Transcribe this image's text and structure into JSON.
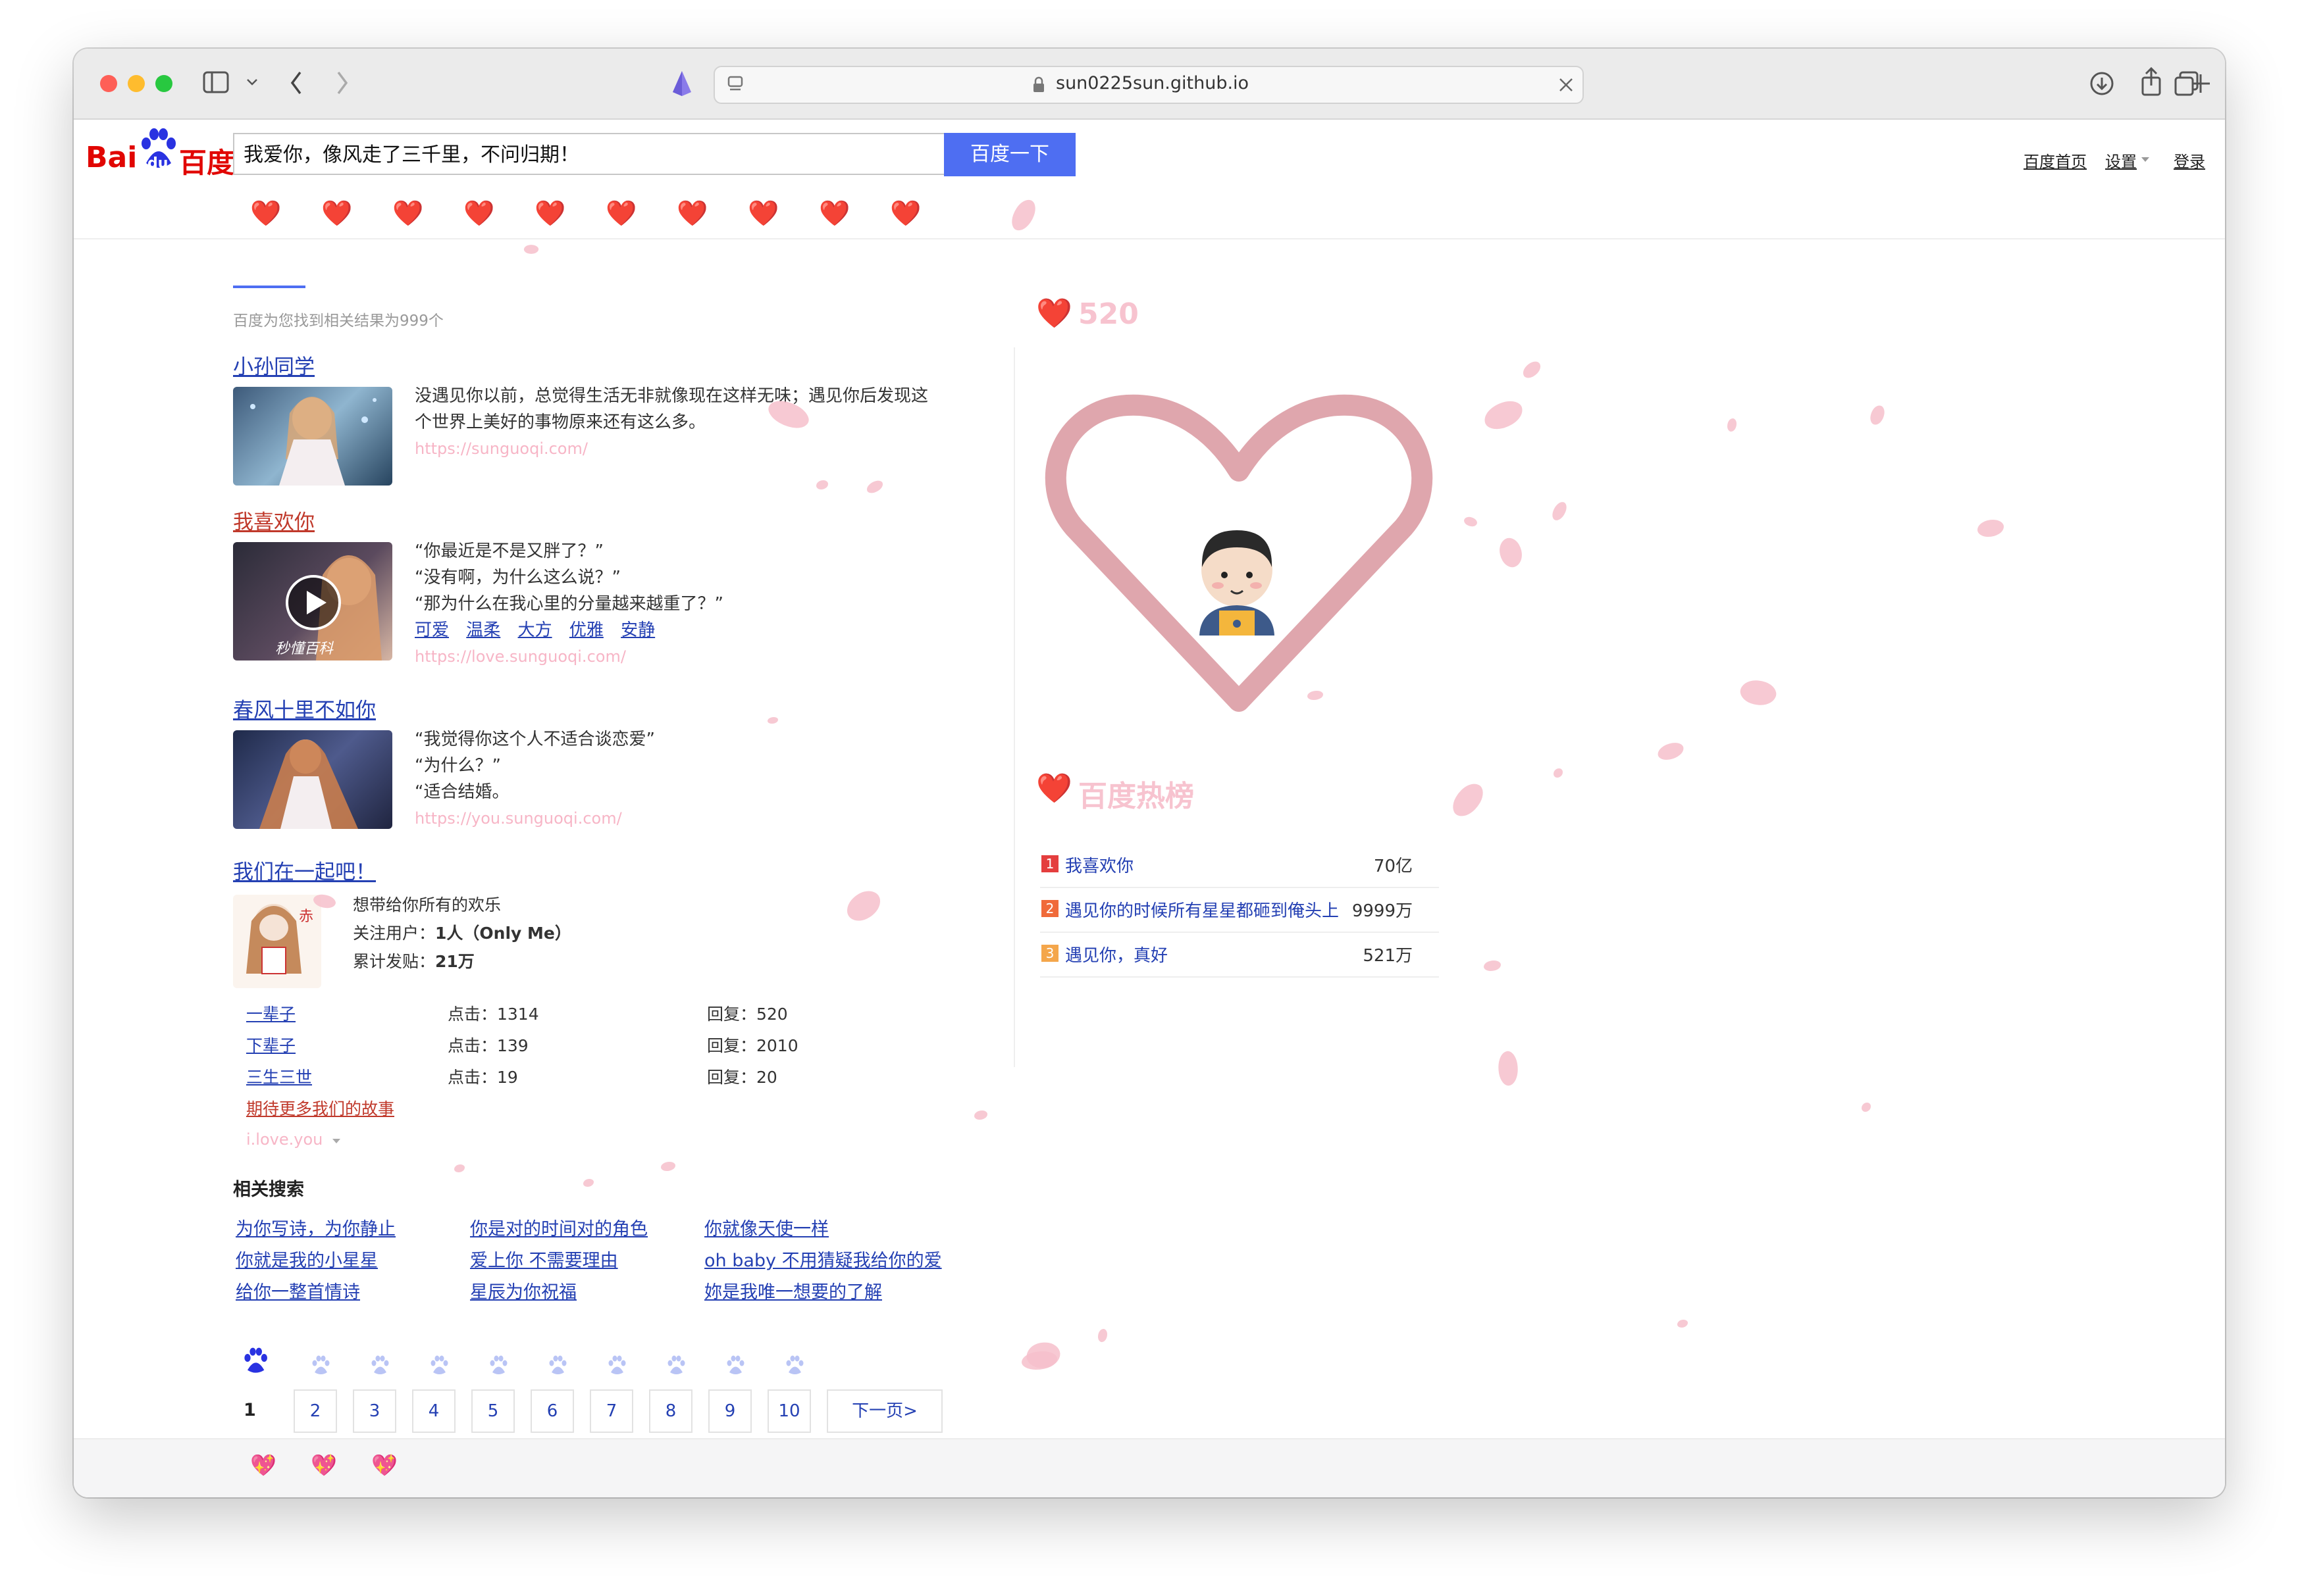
{
  "browser": {
    "url": "sun0225sun.github.io",
    "icons": {
      "sidebar": "sidebar-icon",
      "back": "chevron-left-icon",
      "forward": "chevron-right-icon",
      "download": "download-icon",
      "share": "share-icon",
      "new_tab": "plus-icon",
      "tabs": "tabs-icon",
      "lock": "lock-icon",
      "close": "close-icon",
      "extension": "extension-icon"
    }
  },
  "header": {
    "logo_bai": "Bai",
    "logo_du": "du",
    "logo_cn": "百度",
    "search_value": "我爱你，像风走了三千里，不问归期！",
    "search_button": "百度一下",
    "links": {
      "home": "百度首页",
      "settings": "设置",
      "login": "登录"
    }
  },
  "tabs": {
    "heart": "❤️",
    "count": 10
  },
  "result_count": "百度为您找到相关结果为999个",
  "results": [
    {
      "title": "小孙同学",
      "lines": [
        "没遇见你以前，总觉得生活无非就像现在这样无味；遇见你后发现这",
        "个世界上美好的事物原来还有这么多。"
      ],
      "url": "https://sunguoqi.com/"
    },
    {
      "title": "我喜欢你",
      "lines": [
        "“你最近是不是又胖了？”",
        "“没有啊，为什么这么说？”",
        "“那为什么在我心里的分量越来越重了？”"
      ],
      "tags": [
        "可爱",
        "温柔",
        "大方",
        "优雅",
        "安静"
      ],
      "url": "https://love.sunguoqi.com/",
      "video_caption": "秒懂百科"
    },
    {
      "title": "春风十里不如你",
      "lines": [
        "“我觉得你这个人不适合谈恋爱”",
        "“为什么？”",
        "“适合结婚。"
      ],
      "url": "https://you.sunguoqi.com/"
    }
  ],
  "tieba": {
    "title": "我们在一起吧！",
    "tagline": "想带给你所有的欢乐",
    "followers_label": "关注用户：",
    "followers_value": "1人（Only Me）",
    "posts_label": "累计发贴：",
    "posts_value": "21万",
    "threads": [
      {
        "name": "一辈子",
        "clicks": "点击：1314",
        "replies": "回复：520"
      },
      {
        "name": "下辈子",
        "clicks": "点击：139",
        "replies": "回复：2010"
      },
      {
        "name": "三生三世",
        "clicks": "点击：19",
        "replies": "回复：20"
      }
    ],
    "more": "期待更多我们的故事",
    "source": "i.love.you"
  },
  "related": {
    "title": "相关搜索",
    "items": [
      "为你写诗，为你静止",
      "你是对的时间对的角色",
      "你就像天使一样",
      "你就是我的小星星",
      "爱上你 不需要理由",
      "oh baby 不用猜疑我给你的爱",
      "给你一整首情诗",
      "星辰为你祝福",
      "妳是我唯一想要的了解"
    ]
  },
  "pagination": {
    "current": "1",
    "pages": [
      "2",
      "3",
      "4",
      "5",
      "6",
      "7",
      "8",
      "9",
      "10"
    ],
    "next": "下一页>"
  },
  "sidebar": {
    "score_icon": "❤️",
    "score": "520",
    "hot_title": "百度热榜",
    "hot": [
      {
        "rank": "1",
        "text": "我喜欢你",
        "value": "70亿",
        "color": "#e43e3e"
      },
      {
        "rank": "2",
        "text": "遇见你的时候所有星星都砸到俺头上",
        "value": "9999万",
        "color": "#f06a3a"
      },
      {
        "rank": "3",
        "text": "遇见你，真好",
        "value": "521万",
        "color": "#f4a64b"
      }
    ]
  },
  "footer": {
    "icons": [
      "💖",
      "💖",
      "💖"
    ]
  },
  "colors": {
    "accent": "#4e6ef2",
    "link": "#2440b3",
    "visited": "#c0392b",
    "heart_outline": "#dfa6ad",
    "url": "#f7b5c6"
  }
}
